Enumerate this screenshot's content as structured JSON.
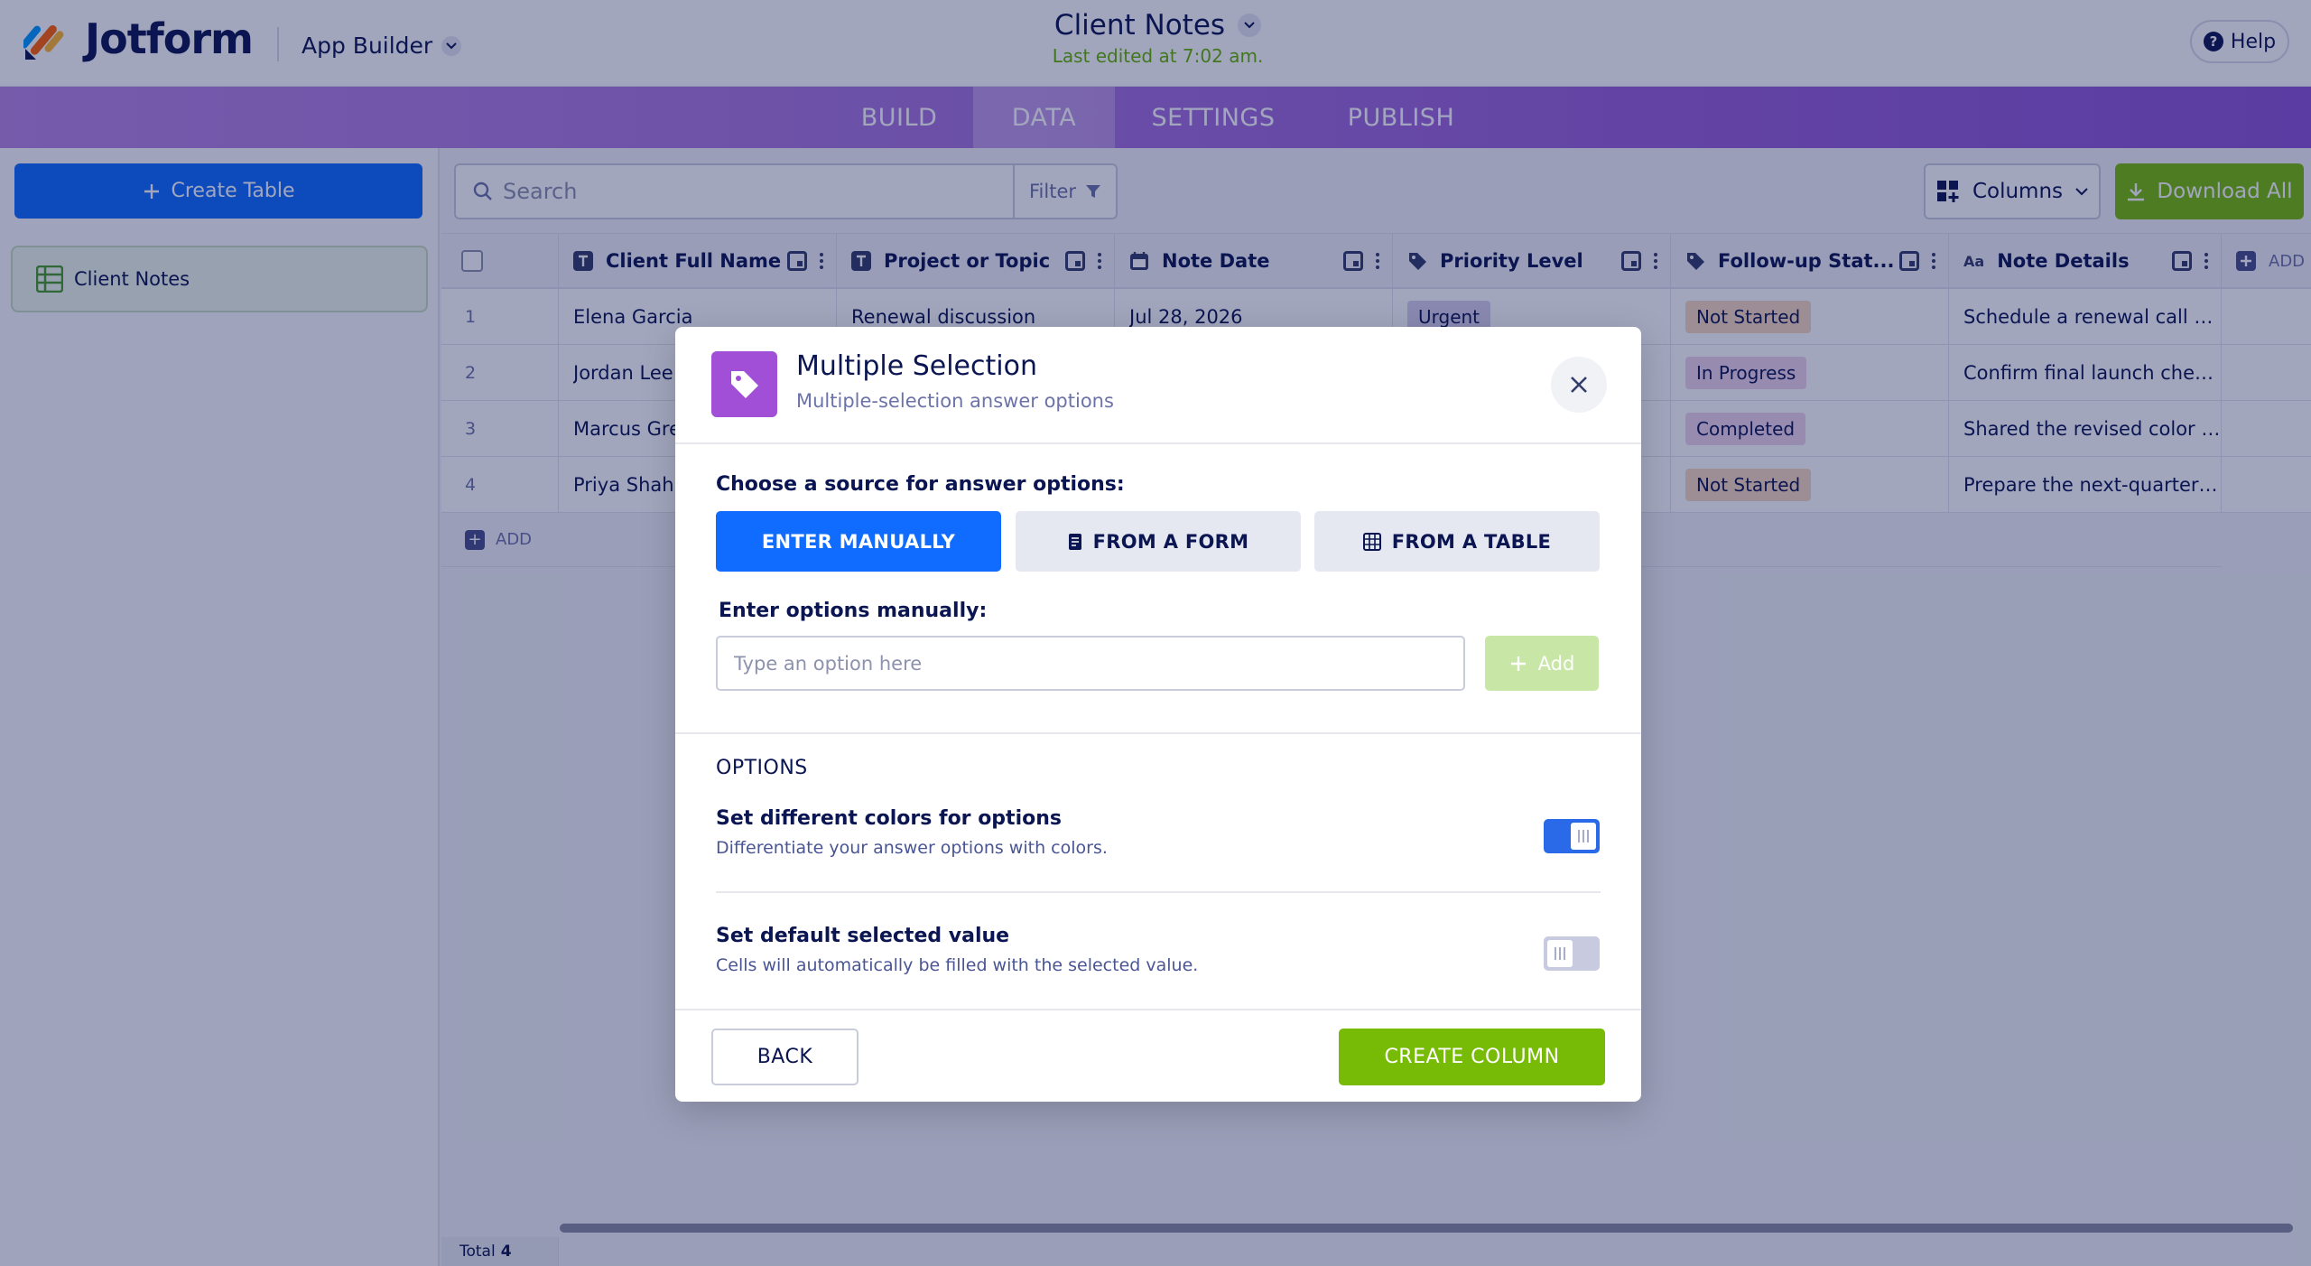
{
  "header": {
    "brand": "Jotform",
    "app_builder_label": "App Builder",
    "app_title": "Client Notes",
    "last_edited": "Last edited at 7:02 am.",
    "help_label": "Help"
  },
  "nav": {
    "tabs": [
      {
        "label": "BUILD",
        "active": false
      },
      {
        "label": "DATA",
        "active": true
      },
      {
        "label": "SETTINGS",
        "active": false
      },
      {
        "label": "PUBLISH",
        "active": false
      }
    ]
  },
  "sidebar": {
    "create_table_label": "Create Table",
    "tables": [
      {
        "label": "Client Notes"
      }
    ]
  },
  "toolbar": {
    "search_placeholder": "Search",
    "filter_label": "Filter",
    "columns_label": "Columns",
    "download_label": "Download All"
  },
  "table": {
    "columns": [
      {
        "label": "Client Full Name",
        "icon": "text-type-icon"
      },
      {
        "label": "Project or Topic",
        "icon": "text-type-icon"
      },
      {
        "label": "Note Date",
        "icon": "calendar-icon"
      },
      {
        "label": "Priority Level",
        "icon": "tag-icon"
      },
      {
        "label": "Follow-up Stat...",
        "icon": "tag-icon"
      },
      {
        "label": "Note Details",
        "icon": "long-text-icon"
      },
      {
        "label": "ADD",
        "icon": "plus-icon"
      }
    ],
    "rows": [
      {
        "num": "1",
        "name": "Elena Garcia",
        "topic": "Renewal discussion",
        "date": "Jul 28, 2026",
        "priority": "Urgent",
        "status": "Not Started",
        "details": "Schedule a renewal call an..."
      },
      {
        "num": "2",
        "name": "Jordan Lee",
        "topic": "",
        "date": "",
        "priority": "",
        "status": "In Progress",
        "details": "Confirm final launch chec..."
      },
      {
        "num": "3",
        "name": "Marcus Gre",
        "topic": "",
        "date": "",
        "priority": "",
        "status": "Completed",
        "details": "Shared the revised color di..."
      },
      {
        "num": "4",
        "name": "Priya Shah",
        "topic": "",
        "date": "",
        "priority": "",
        "status": "Not Started",
        "details": "Prepare the next-quarter o..."
      }
    ],
    "add_row_label": "ADD",
    "total_label": "Total",
    "total_count": "4"
  },
  "colors": {
    "primary_blue": "#0f6cff",
    "green": "#78bb07",
    "purple_icon": "#a04fd6",
    "badge_urgent_bg": "#d9d1ec",
    "badge_not_started_bg": "#f6d9bd",
    "badge_in_progress_bg": "#eed3ea",
    "badge_completed_bg": "#eed3ea"
  },
  "modal": {
    "title": "Multiple Selection",
    "subtitle": "Multiple-selection answer options",
    "source_label": "Choose a source for answer options:",
    "source_buttons": [
      {
        "label": "ENTER MANUALLY",
        "active": true
      },
      {
        "label": "FROM A FORM",
        "active": false,
        "icon": "form-icon"
      },
      {
        "label": "FROM A TABLE",
        "active": false,
        "icon": "table-grid-icon"
      }
    ],
    "manual_label": "Enter options manually:",
    "option_placeholder": "Type an option here",
    "option_value": "",
    "add_label": "Add",
    "options_title": "OPTIONS",
    "settings": [
      {
        "title": "Set different colors for options",
        "desc": "Differentiate your answer options with colors.",
        "enabled": true
      },
      {
        "title": "Set default selected value",
        "desc": "Cells will automatically be filled with the selected value.",
        "enabled": false
      }
    ],
    "back_label": "BACK",
    "create_label": "CREATE COLUMN"
  }
}
